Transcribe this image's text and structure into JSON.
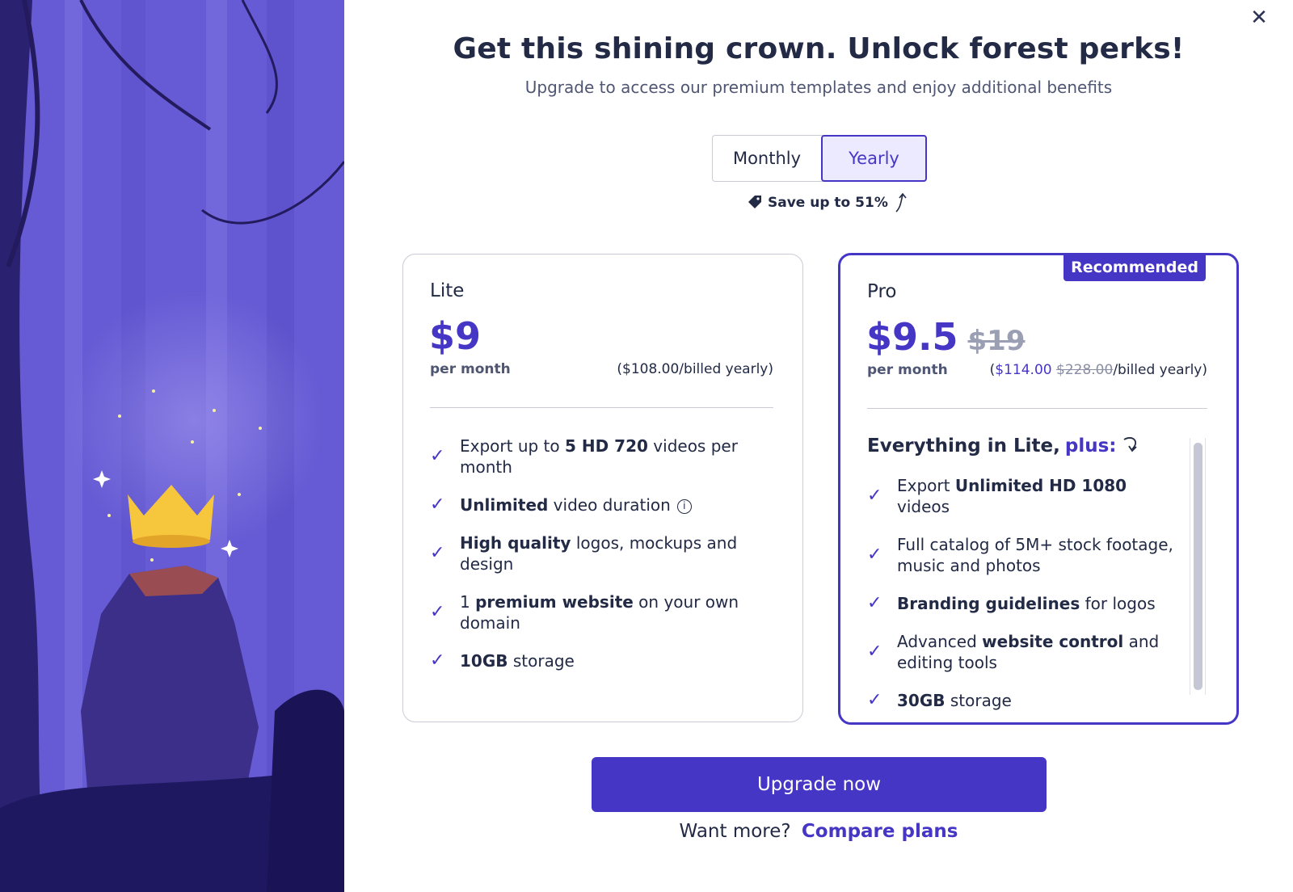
{
  "colors": {
    "accent": "#4636c6",
    "text": "#222a45",
    "muted": "#4f5673"
  },
  "header": {
    "title": "Get this shining crown. Unlock forest perks!",
    "subtitle": "Upgrade to access our premium templates and enjoy additional benefits"
  },
  "billing_toggle": {
    "monthly": "Monthly",
    "yearly": "Yearly",
    "selected": "Yearly"
  },
  "save_note": "Save up to 51%",
  "lite": {
    "name": "Lite",
    "price": "$9",
    "per": "per month",
    "billed": "($108.00/billed yearly)",
    "features": [
      {
        "pre": "Export up to ",
        "bold": "5 HD 720",
        "post": " videos per month"
      },
      {
        "pre": "",
        "bold": "Unlimited",
        "post": " video duration"
      },
      {
        "pre": "",
        "bold": "High quality",
        "post": " logos, mockups and design"
      },
      {
        "pre": "1 ",
        "bold": "premium website",
        "post": " on your own domain"
      },
      {
        "pre": "",
        "bold": "10GB",
        "post": " storage"
      }
    ]
  },
  "pro": {
    "badge": "Recommended",
    "name": "Pro",
    "price": "$9.5",
    "old_price": "$19",
    "per": "per month",
    "billed_open": "(",
    "billed_new": "$114.00",
    "billed_old": "$228.00",
    "billed_close": "/billed yearly)",
    "features_head": "Everything in Lite,",
    "features_head_plus": "plus:",
    "features": [
      {
        "pre": "Export ",
        "bold": "Unlimited HD 1080",
        "post": " videos"
      },
      {
        "pre": "Full catalog of 5M+ stock footage, music and photos",
        "bold": "",
        "post": ""
      },
      {
        "pre": "",
        "bold": "Branding guidelines",
        "post": " for logos"
      },
      {
        "pre": "Advanced ",
        "bold": "website control",
        "post": " and editing tools"
      },
      {
        "pre": "",
        "bold": "30GB",
        "post": " storage"
      }
    ]
  },
  "cta": "Upgrade now",
  "footer": {
    "prompt": "Want more?",
    "link": "Compare plans"
  },
  "icons": {
    "close": "close-icon",
    "tag": "tag-icon",
    "check": "check-icon",
    "info": "info-icon",
    "crown": "crown-icon"
  }
}
